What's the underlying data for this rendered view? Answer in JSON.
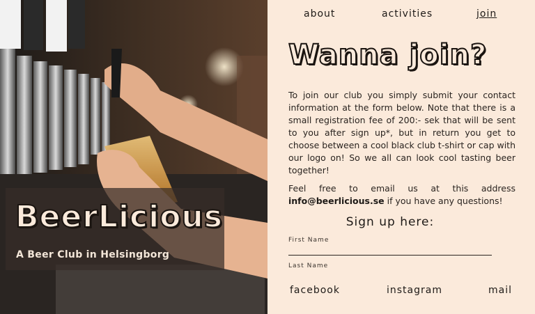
{
  "hero": {
    "brand_title": "BeerLicious",
    "brand_subtitle": "A Beer Club in Helsingborg"
  },
  "nav": {
    "items": [
      {
        "label": "about"
      },
      {
        "label": "activities"
      },
      {
        "label": "join",
        "active": true
      }
    ]
  },
  "main": {
    "heading": "Wanna join?",
    "paragraph1": "To join our club you simply submit your contact information at the form below. Note that there is a small registration fee of 200:- sek that will be sent to you after sign up*, but in return you get to choose between a cool black club t-shirt or cap with our logo on! So we all can look cool tasting beer together!",
    "paragraph2_before": "Feel free to email us at this address ",
    "email": "info@beerlicious.se",
    "paragraph2_after": " if you have any questions!",
    "signup_title": "Sign up here:"
  },
  "form": {
    "first_name_label": "First Name",
    "first_name_value": "",
    "last_name_label": "Last Name",
    "last_name_value": ""
  },
  "footer": {
    "links": [
      {
        "label": "facebook"
      },
      {
        "label": "instagram"
      },
      {
        "label": "mail"
      }
    ]
  },
  "colors": {
    "background": "#fbeadb",
    "text": "#1e1a17",
    "overlay": "#372d28"
  }
}
